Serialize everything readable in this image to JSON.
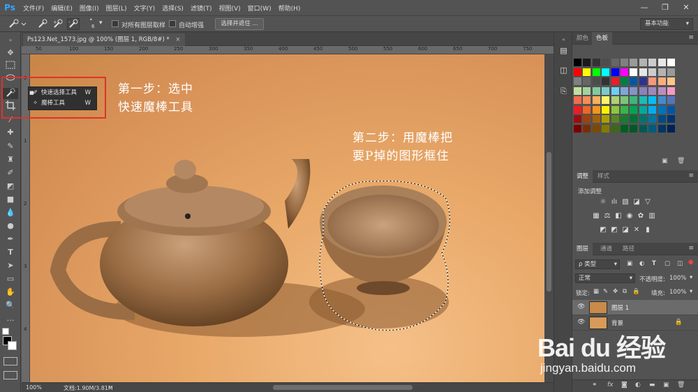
{
  "app": {
    "logo": "Ps"
  },
  "menu": [
    "文件(F)",
    "编辑(E)",
    "图像(I)",
    "图层(L)",
    "文字(Y)",
    "选择(S)",
    "滤镜(T)",
    "视图(V)",
    "窗口(W)",
    "帮助(H)"
  ],
  "window_controls": {
    "minimize": "—",
    "restore": "❐",
    "close": "✕"
  },
  "options": {
    "brush_size": "6",
    "sample_all_layers": "对所有图层取样",
    "auto_enhance": "自动增强",
    "select_and_mask": "选择并遮住 ...",
    "workspace": "基本功能"
  },
  "document": {
    "tab_title": "Ps123.Net_1573.jpg @ 100% (图层 1, RGB/8#) *",
    "close": "×"
  },
  "tool_popup": {
    "items": [
      {
        "label": "快速选择工具",
        "shortcut": "W",
        "active": true
      },
      {
        "label": "魔棒工具",
        "shortcut": "W",
        "active": false
      }
    ]
  },
  "annotations": {
    "step1_line1": "第一步：选中",
    "step1_line2": "快速魔棒工具",
    "step2_line1": "第二步：用魔棒把",
    "step2_line2": "要P掉的图形框住"
  },
  "status": {
    "zoom": "100%",
    "doc_size": "文档:1.90M/3.81M"
  },
  "rulers": {
    "h": [
      "50",
      "100",
      "150",
      "200",
      "250",
      "300",
      "350",
      "400",
      "450",
      "500",
      "550",
      "600",
      "650",
      "700",
      "750"
    ],
    "v": [
      "0",
      "1",
      "2",
      "3",
      "4"
    ]
  },
  "panels": {
    "color_tabs": [
      "颜色",
      "色板"
    ],
    "adjust_tabs": [
      "调整",
      "样式"
    ],
    "adjust_title": "添加调整",
    "layer_tabs": [
      "图层",
      "通道",
      "路径"
    ],
    "kind_filter": "ρ 类型",
    "blend_mode": "正常",
    "opacity_label": "不透明度:",
    "opacity_value": "100%",
    "lock_label": "锁定:",
    "fill_label": "填充:",
    "fill_value": "100%",
    "layers": [
      {
        "name": "图层 1",
        "active": true,
        "locked": false
      },
      {
        "name": "背景",
        "active": false,
        "locked": true
      }
    ]
  },
  "watermark": {
    "logo": "Bai du 经验",
    "url": "jingyan.baidu.com"
  },
  "swatch_colors": [
    [
      "#000000",
      "#1a1a1a",
      "#333333",
      "#4d4d4d",
      "#666666",
      "#808080",
      "#999999",
      "#b3b3b3",
      "#cccccc",
      "#e6e6e6",
      "#ffffff"
    ],
    [
      "#ff0000",
      "#ffff00",
      "#00ff00",
      "#00ffff",
      "#0000ff",
      "#ff00ff",
      "#ffffff",
      "#e6e6e6",
      "#cccccc",
      "#b3b3b3",
      "#999999"
    ],
    [
      "#808080",
      "#666666",
      "#4d4d4d",
      "#333333",
      "#ed1c24",
      "#008040",
      "#0057a8",
      "#2e3192",
      "#f7977a",
      "#f9ad81",
      "#fdc68a"
    ],
    [
      "#c4df9b",
      "#a3d39c",
      "#82ca9c",
      "#7accc8",
      "#6dcff6",
      "#7ea7d8",
      "#8493ca",
      "#8882be",
      "#a187be",
      "#bc8dbf",
      "#f49ac2"
    ],
    [
      "#f26c4f",
      "#f68e56",
      "#fbaf5d",
      "#fff568",
      "#acd372",
      "#7cc576",
      "#3bb878",
      "#1abbb4",
      "#00bff3",
      "#438ccb",
      "#5574b9"
    ],
    [
      "#ed1c24",
      "#f26522",
      "#f7941d",
      "#fff200",
      "#8dc63f",
      "#39b54a",
      "#00a651",
      "#00a99d",
      "#00aeef",
      "#0072bc",
      "#0054a6"
    ],
    [
      "#9e0b0f",
      "#a0410d",
      "#a36209",
      "#aba000",
      "#598527",
      "#1a7b30",
      "#007236",
      "#00746b",
      "#0076a3",
      "#004b80",
      "#003471"
    ],
    [
      "#790000",
      "#7b2e00",
      "#7d4900",
      "#827b00",
      "#406618",
      "#005e20",
      "#005826",
      "#005952",
      "#005b7f",
      "#003663",
      "#002157"
    ]
  ]
}
